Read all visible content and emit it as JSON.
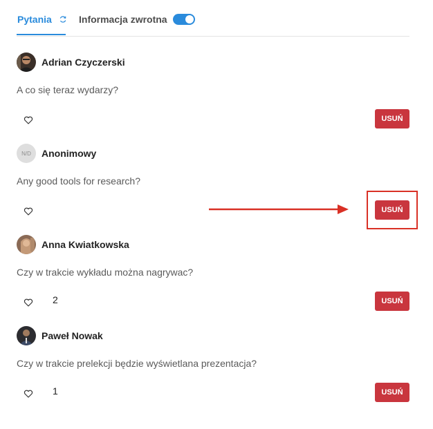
{
  "tabs": {
    "questions_label": "Pytania",
    "feedback_label": "Informacja zwrotna",
    "feedback_toggle_on": true
  },
  "questions": [
    {
      "author": "Adrian Czyczerski",
      "text": "A co się teraz wydarzy?",
      "likes": "",
      "delete_label": "USUŃ"
    },
    {
      "author": "Anonimowy",
      "avatar_text": "N/D",
      "text": "Any good tools for research?",
      "likes": "",
      "delete_label": "USUŃ"
    },
    {
      "author": "Anna Kwiatkowska",
      "text": "Czy w trakcie wykładu można nagrywac?",
      "likes": "2",
      "delete_label": "USUŃ"
    },
    {
      "author": "Paweł Nowak",
      "text": "Czy w trakcie prelekcji będzie wyświetlana prezentacja?",
      "likes": "1",
      "delete_label": "USUŃ"
    }
  ],
  "colors": {
    "accent": "#2a8bdc",
    "delete": "#c9363e",
    "annotation": "#d93025"
  }
}
